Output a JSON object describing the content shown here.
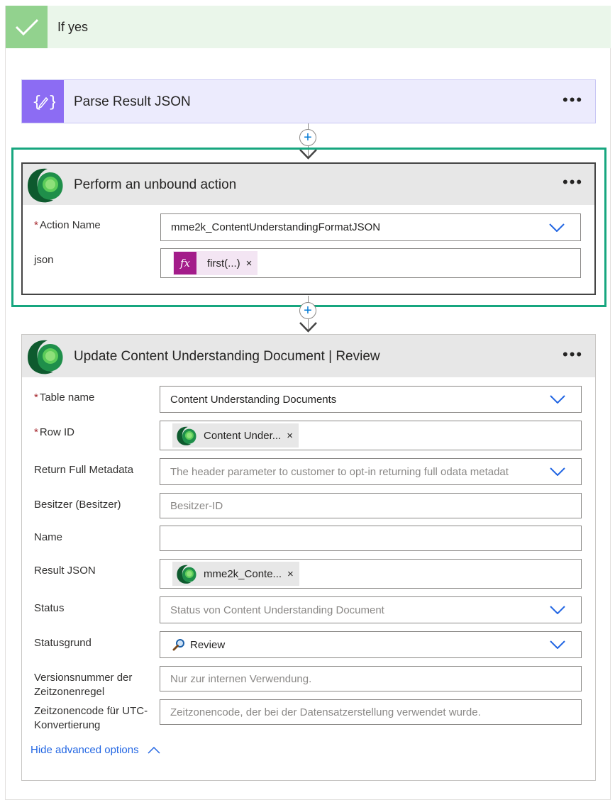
{
  "condition": {
    "title": "If yes"
  },
  "parse_card": {
    "title": "Parse Result JSON",
    "more": "•••"
  },
  "unbound_card": {
    "title": "Perform an unbound action",
    "more": "•••",
    "fields": {
      "action_name": {
        "label": "Action Name",
        "required": "*",
        "value": "mme2k_ContentUnderstandingFormatJSON"
      },
      "json": {
        "label": "json",
        "token": "first(...)",
        "token_close": "×"
      }
    }
  },
  "update_card": {
    "title": "Update Content Understanding Document | Review",
    "more": "•••",
    "fields": {
      "table_name": {
        "label": "Table name",
        "required": "*",
        "value": "Content Understanding Documents"
      },
      "row_id": {
        "label": "Row ID",
        "required": "*",
        "token": "Content Under...",
        "token_close": "×"
      },
      "return_full_metadata": {
        "label": "Return Full Metadata",
        "placeholder": "The header parameter to customer to opt-in returning full odata metadat"
      },
      "besitzer": {
        "label": "Besitzer (Besitzer)",
        "placeholder": "Besitzer-ID"
      },
      "name": {
        "label": "Name",
        "value": ""
      },
      "result_json": {
        "label": "Result JSON",
        "token": "mme2k_Conte...",
        "token_close": "×"
      },
      "status": {
        "label": "Status",
        "placeholder": "Status von Content Understanding Document"
      },
      "statusgrund": {
        "label": "Statusgrund",
        "value": "Review"
      },
      "versionsnummer": {
        "label_line1": "Versionsnummer der",
        "label_line2": "Zeitzonenregel",
        "placeholder": "Nur zur internen Verwendung."
      },
      "zeitzonencode": {
        "label_line1": "Zeitzonencode für UTC-",
        "label_line2": "Konvertierung",
        "placeholder": "Zeitzonencode, der bei der Datensatzerstellung verwendet wurde."
      }
    },
    "advanced_toggle": "Hide advanced options"
  },
  "colors": {
    "condition_bg": "#eaf6ea",
    "condition_icon": "#92d28e",
    "parse_bg": "#ecebfd",
    "parse_icon": "#8c6cf3",
    "highlight": "#17a67f",
    "fx_token": "#a31c8a",
    "link": "#2266e3"
  },
  "icons": [
    "check-icon",
    "parse-json-icon",
    "dataverse-icon",
    "plus-icon",
    "arrow-down-icon",
    "chevron-down-icon",
    "fx-icon",
    "close-icon",
    "magnifier-icon",
    "chevron-up-icon"
  ]
}
